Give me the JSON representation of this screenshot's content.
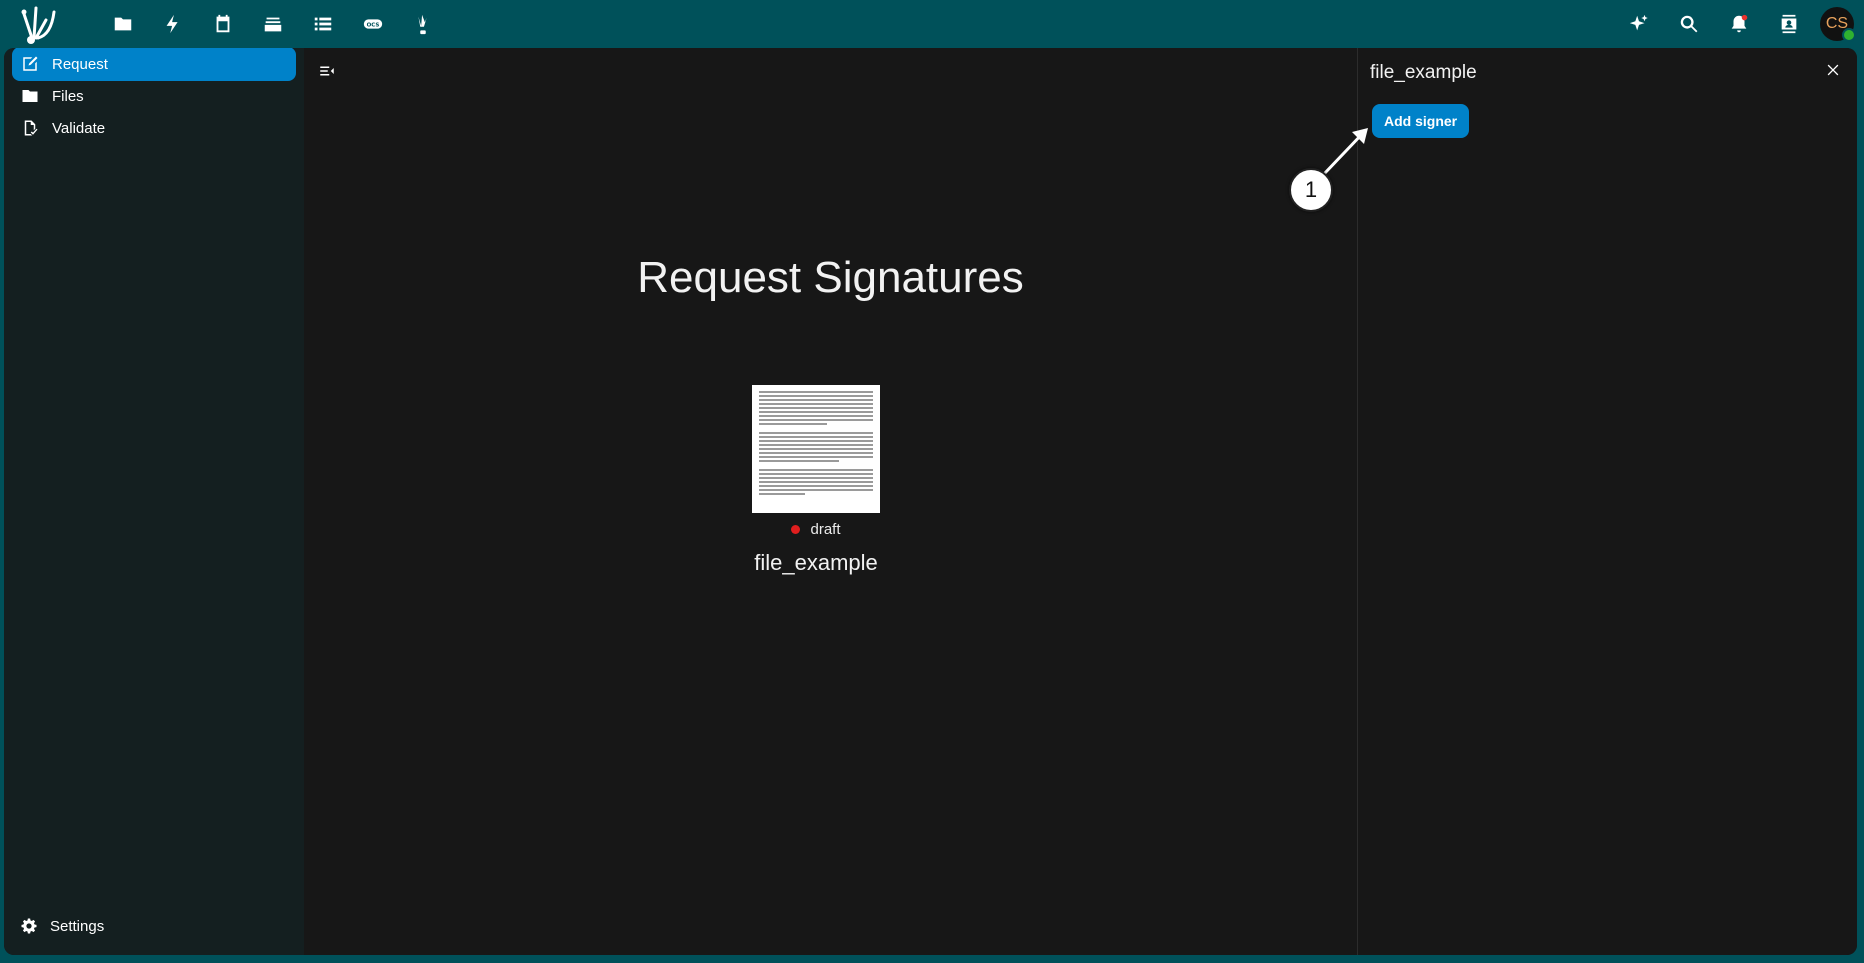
{
  "colors": {
    "header_bg": "#00515a",
    "content_bg": "#171717",
    "sidebar_bg": "#141f20",
    "accent": "#0082c9",
    "status_draft": "#e01e1e",
    "avatar_text": "#e8a25c"
  },
  "header": {
    "logo": "app-logo",
    "apps": [
      {
        "name": "files-app",
        "icon": "folder-icon"
      },
      {
        "name": "activity-app",
        "icon": "lightning-icon"
      },
      {
        "name": "calendar-app",
        "icon": "calendar-icon"
      },
      {
        "name": "deck-app",
        "icon": "stack-icon"
      },
      {
        "name": "tasks-app",
        "icon": "list-icon"
      },
      {
        "name": "ocs-app",
        "icon": "ocs-icon"
      },
      {
        "name": "libresign-app",
        "icon": "libresign-icon"
      }
    ],
    "right": {
      "assistant_icon": "sparkle-icon",
      "search_icon": "search-icon",
      "notifications_icon": "bell-icon",
      "contacts_icon": "contacts-icon",
      "avatar_initials": "CS"
    }
  },
  "sidebar": {
    "items": [
      {
        "label": "Request",
        "icon": "request-icon",
        "active": true
      },
      {
        "label": "Files",
        "icon": "folder-icon",
        "active": false
      },
      {
        "label": "Validate",
        "icon": "validate-icon",
        "active": false
      }
    ],
    "settings_label": "Settings"
  },
  "main": {
    "title": "Request Signatures",
    "file": {
      "status": "draft",
      "name": "file_example"
    }
  },
  "panel": {
    "title": "file_example",
    "add_signer_label": "Add signer"
  },
  "annotation": {
    "callout_number": "1"
  }
}
